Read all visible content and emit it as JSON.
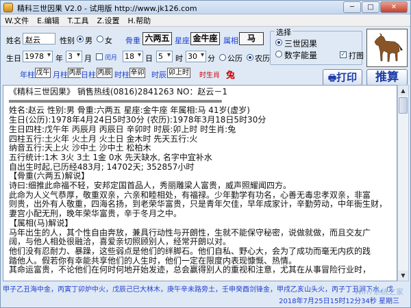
{
  "window": {
    "title": "精科三世因果 V2.0 - 试用版 http://www.jk126.com",
    "min_label": "─",
    "max_label": "□",
    "close_label": "✕"
  },
  "menu": [
    "W.文件",
    "E.编辑",
    "T.工具",
    "Z.设置",
    "H.帮助"
  ],
  "form": {
    "name_label": "姓名",
    "name_value": "赵云",
    "gender_label": "性别",
    "gender_male": "男",
    "gender_female": "女",
    "bone_label": "骨重",
    "bone_value": "六两五",
    "star_label": "星座",
    "star_value": "金牛座",
    "zodiac_label": "属相",
    "zodiac_value": "马",
    "select_label": "选择",
    "option1": "三世因果",
    "option2": "数字能量",
    "print_check_label": "打图",
    "birth_label": "生日",
    "year_value": "1978",
    "year_unit": "年",
    "month_value": "3",
    "month_unit": "月",
    "leap_label": "闰月",
    "day_value": "18",
    "day_unit": "日",
    "hour_value": "5",
    "hour_unit": "时",
    "minute_value": "30",
    "minute_unit": "分",
    "cal_solar": "公历",
    "cal_lunar": "农历",
    "pillars": [
      {
        "label": "年柱",
        "value": "戊午"
      },
      {
        "label": "月柱",
        "value": "丙辰"
      },
      {
        "label": "日柱",
        "value": "丙辰"
      },
      {
        "label": "时柱",
        "value": "辛卯"
      },
      {
        "label": "时辰",
        "value": "卯上时"
      }
    ],
    "shengxiao_label": "时生肖",
    "shengxiao_value": "兔",
    "print_button": "打印",
    "calc_button": "推算"
  },
  "report": [
    {
      "text": "《精科三世因果》      销售热线(0816)2841263      NO：赵云－1"
    },
    {
      "text": "═══════════════════════════════════════════"
    },
    {
      "text": "姓名:赵云 性别:男 骨重:六两五 星座:金牛座 年属相:马 41岁(虚岁)"
    },
    {
      "text": "生日(公历):1978年4月24日5时30分  (农历):1978年3月18日5时30分"
    },
    {
      "text": "生日四柱:戊午年 丙辰月 丙辰日 辛卯时 时辰:卯上时 时生肖:兔"
    },
    {
      "text": "四柱五行:土火年 火土月 火土日 金木时 先天五行:火"
    },
    {
      "text": "纳音五行:天上火 沙中土 沙中土 松柏木"
    },
    {
      "text": "五行统计:1木 3火 3土 1金 0水  先天缺水, 名字中宜补水"
    },
    {
      "text": "自出生时起,已历经483月; 14702天; 352857小时"
    },
    {
      "text": ""
    },
    {
      "text": "      【骨重(六两五)解说】"
    },
    {
      "text": "    诗曰:细推此命福不轻，安邦定国首品人，秀丽雕梁人富贵，威声照耀闻四方。"
    },
    {
      "text": "    此命为人义气恭厚，敬重双亲，六亲和睦相处，有福禄。少年勤学有功名，心善无毒忠孝双亲，非富"
    },
    {
      "text": "则贵，出外有人敬重，四海名扬，到老荣华富贵，只是青年欠佳，早年成家计，辛勤劳动，中年衙生财，"
    },
    {
      "text": "妻宫小配无刑，晚年荣华富贵，辛于冬月之中。"
    },
    {
      "text": ""
    },
    {
      "text": "      【属相(马)解说】"
    },
    {
      "text": "    马年出生的人，其个性自由奔放，兼具行动性与开朗性，生就不能保守秘密，说做就做，而且交友广"
    },
    {
      "text": "阔，与他人相处很融洽，喜爱亲切照顾别人，经常开朗以对。"
    },
    {
      "text": "    他们没有忍耐力、暴躁，这些弱点是他们的绊脚石。他们自私、野心大，会为了成功而毫无内疚的践"
    },
    {
      "text": "踏他人。假若你有幸能共享他们的人生时，他们一定在限度内表现慷慨、热情。"
    },
    {
      "text": "    其命运富贵，不论他们在何时何地开始发迹，总会赢得别人的重视和注意，尤其在从事冒险行业时，"
    }
  ],
  "status": {
    "ganzhi": "甲子乙丑海中金，丙寅丁卯炉中火，戊辰己巳大林木，庚午辛未路旁土，壬申癸酉剑锋金，甲戌乙亥山头火，丙子丁丑涧下水，戊",
    "datetime": "2018年7月25日15时12分34秒    星期三",
    "watermark": "Win7系统之家"
  }
}
